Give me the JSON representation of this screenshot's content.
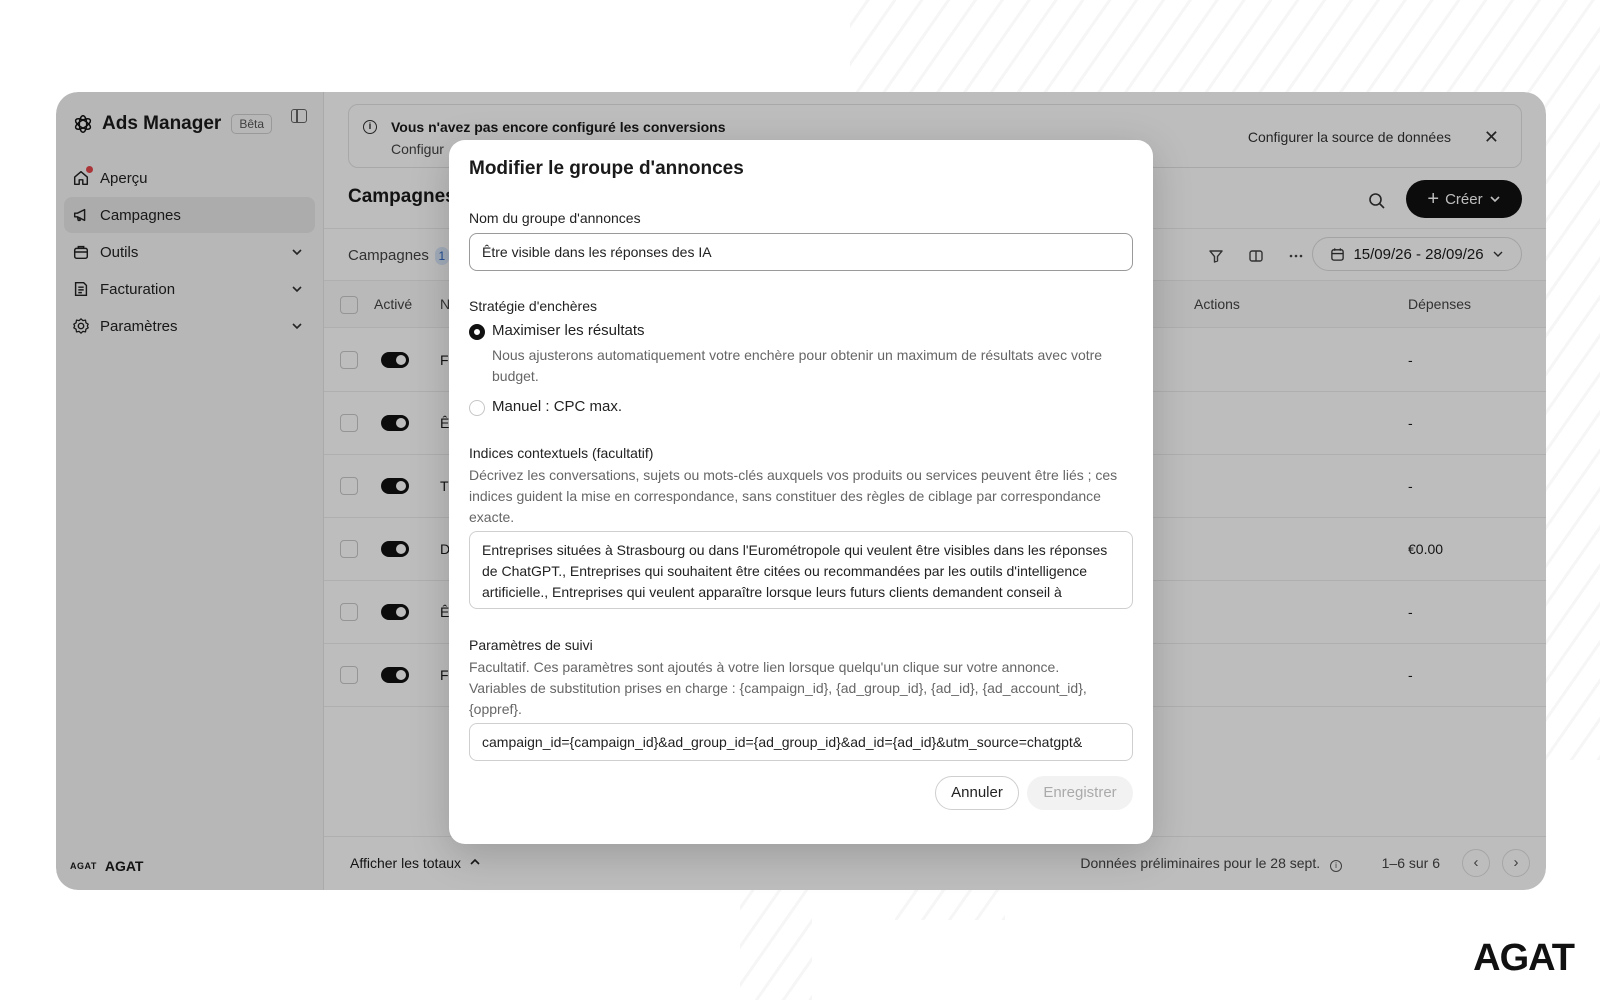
{
  "app": {
    "title": "Ads Manager",
    "beta_badge": "Bêta",
    "workspace_logo": "AGAT",
    "workspace_name": "AGAT"
  },
  "sidebar": {
    "items": [
      {
        "label": "Aperçu",
        "icon": "home-icon"
      },
      {
        "label": "Campagnes",
        "icon": "megaphone-icon"
      },
      {
        "label": "Outils",
        "icon": "briefcase-icon"
      },
      {
        "label": "Facturation",
        "icon": "receipt-icon"
      },
      {
        "label": "Paramètres",
        "icon": "gear-icon"
      }
    ]
  },
  "banner": {
    "title": "Vous n'avez pas encore configuré les conversions",
    "subtitle": "Configur",
    "link": "Configurer la source de données",
    "close": "✕"
  },
  "header": {
    "title": "Campagnes",
    "create_label": "Créer"
  },
  "toolbar": {
    "tab_label": "Campagnes",
    "tab_count": "1",
    "date_range": "15/09/26 - 28/09/26"
  },
  "table": {
    "columns": {
      "active": "Activé",
      "name": "N",
      "actions": "Actions",
      "spend": "Dépenses"
    },
    "rows": [
      {
        "name": "F",
        "spend": "-"
      },
      {
        "name": "Ê",
        "spend": "-"
      },
      {
        "name": "T",
        "spend": "-"
      },
      {
        "name": "D",
        "spend": "€0.00"
      },
      {
        "name": "Ê",
        "spend": "-"
      },
      {
        "name": "F",
        "spend": "-"
      }
    ]
  },
  "footer": {
    "totals": "Afficher les totaux",
    "preliminary": "Données préliminaires pour le 28 sept.",
    "pagination": "1–6 sur 6",
    "prev": "‹",
    "next": "›"
  },
  "modal": {
    "title": "Modifier le groupe d'annonces",
    "name_label": "Nom du groupe d'annonces",
    "name_value": "Être visible dans les réponses des IA",
    "bid_label": "Stratégie d'enchères",
    "bid_option_1": "Maximiser les résultats",
    "bid_option_1_desc": "Nous ajusterons automatiquement votre enchère pour obtenir un maximum de résultats avec votre budget.",
    "bid_option_2": "Manuel : CPC max.",
    "bid_selected": "Maximiser les résultats",
    "context_label": "Indices contextuels (facultatif)",
    "context_help": "Décrivez les conversations, sujets ou mots-clés auxquels vos produits ou services peuvent être liés ; ces indices guident la mise en correspondance, sans constituer des règles de ciblage par correspondance exacte.",
    "context_value": "Entreprises situées à Strasbourg ou dans l'Eurométropole qui veulent être visibles dans les réponses de ChatGPT., Entreprises qui souhaitent être citées ou recommandées par les outils d'intelligence artificielle., Entreprises qui veulent apparaître lorsque leurs futurs clients demandent conseil à ChatGPT., Entreprises qui cherchent à être mieux positionnées dans les réponses des IA",
    "tracking_label": "Paramètres de suivi",
    "tracking_help": "Facultatif. Ces paramètres sont ajoutés à votre lien lorsque quelqu'un clique sur votre annonce. Variables de substitution prises en charge : {campaign_id}, {ad_group_id}, {ad_id}, {ad_account_id}, {oppref}.",
    "tracking_value": "campaign_id={campaign_id}&ad_group_id={ad_group_id}&ad_id={ad_id}&utm_source=chatgpt&",
    "cancel_label": "Annuler",
    "save_label": "Enregistrer"
  },
  "watermark": "AGAT"
}
